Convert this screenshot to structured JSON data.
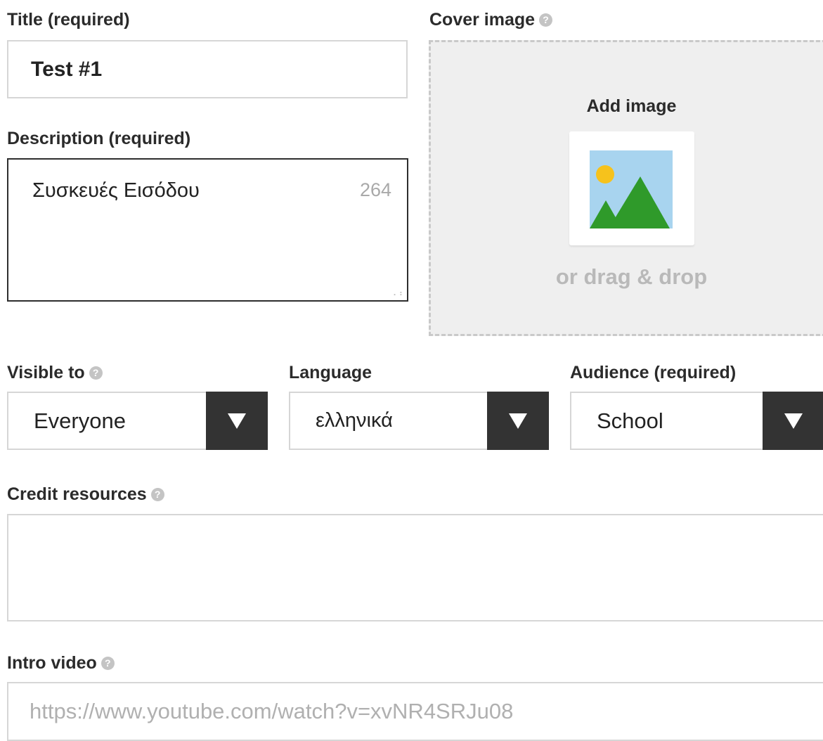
{
  "title_field": {
    "label": "Title (required)",
    "value": "Test #1"
  },
  "description_field": {
    "label": "Description (required)",
    "value": "Συσκευές Εισόδου",
    "remaining_chars": "264"
  },
  "cover_image": {
    "label": "Cover image",
    "add_label": "Add image",
    "drag_text": "or drag & drop"
  },
  "visible_to": {
    "label": "Visible to",
    "value": "Everyone"
  },
  "language": {
    "label": "Language",
    "value": "ελληνικά"
  },
  "audience": {
    "label": "Audience (required)",
    "value": "School"
  },
  "credit_resources": {
    "label": "Credit resources",
    "value": ""
  },
  "intro_video": {
    "label": "Intro video",
    "placeholder": "https://www.youtube.com/watch?v=xvNR4SRJu08"
  },
  "icons": {
    "help": "help-icon",
    "image_placeholder": "image-placeholder-icon",
    "dropdown": "dropdown-arrow-icon"
  },
  "colors": {
    "dropdown_button": "#333333",
    "help_icon": "#c4c4c4",
    "sky": "#a8d4ef",
    "sun": "#f6c21c",
    "mountain": "#2f9a2a"
  }
}
